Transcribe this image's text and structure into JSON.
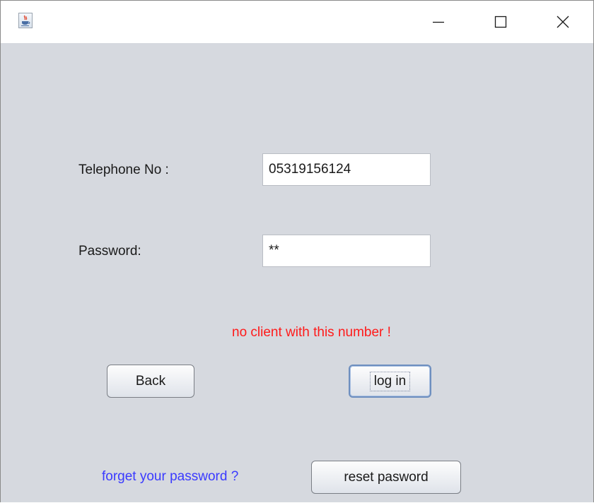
{
  "window": {
    "icon": "java-cup-icon",
    "controls": {
      "minimize": "minimize-icon",
      "maximize": "maximize-icon",
      "close": "close-icon"
    }
  },
  "form": {
    "telephone_label": "Telephone No :",
    "telephone_value": "05319156124",
    "password_label": "Password:",
    "password_value": "**"
  },
  "error_message": "no client with this number !",
  "buttons": {
    "back": "Back",
    "login": "log in",
    "reset": "reset pasword"
  },
  "forget_link": "forget your password ?",
  "colors": {
    "background": "#d6d9df",
    "error": "#ff1a1a",
    "link": "#3a3aff"
  }
}
